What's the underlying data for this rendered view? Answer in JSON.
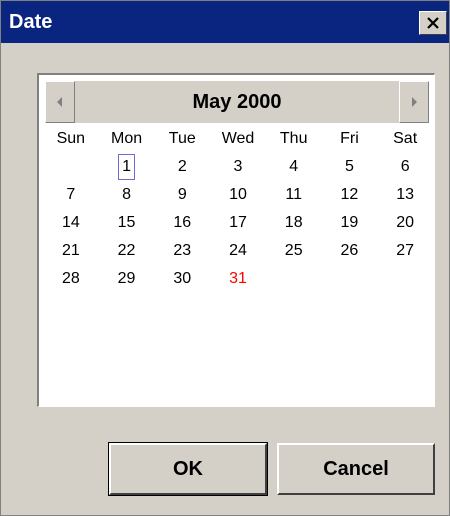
{
  "window": {
    "title": "Date",
    "close_icon": "close-icon"
  },
  "calendar": {
    "month_label": "May 2000",
    "prev_icon": "triangle-left-icon",
    "next_icon": "triangle-right-icon",
    "weekdays": [
      "Sun",
      "Mon",
      "Tue",
      "Wed",
      "Thu",
      "Fri",
      "Sat"
    ],
    "weeks": [
      [
        "",
        "1",
        "2",
        "3",
        "4",
        "5",
        "6"
      ],
      [
        "7",
        "8",
        "9",
        "10",
        "11",
        "12",
        "13"
      ],
      [
        "14",
        "15",
        "16",
        "17",
        "18",
        "19",
        "20"
      ],
      [
        "21",
        "22",
        "23",
        "24",
        "25",
        "26",
        "27"
      ],
      [
        "28",
        "29",
        "30",
        "31",
        "",
        "",
        ""
      ]
    ],
    "selected_day": "1",
    "highlighted_day": "31",
    "highlight_color": "#ff0000",
    "selection_border_color": "#6a6ad8"
  },
  "buttons": {
    "ok": "OK",
    "cancel": "Cancel"
  },
  "colors": {
    "titlebar": "#0a2580",
    "face": "#d4d0c8"
  }
}
